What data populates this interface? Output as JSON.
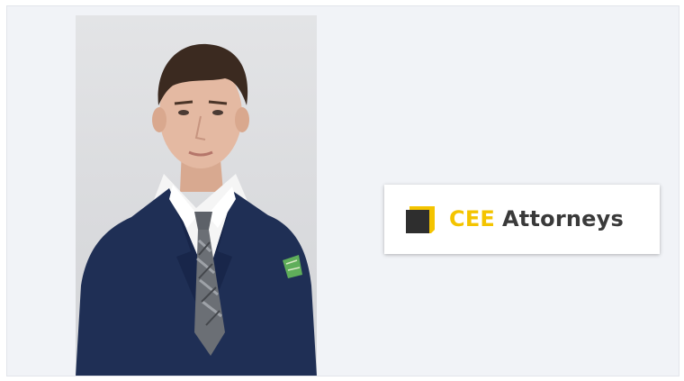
{
  "logo": {
    "brand_primary": "CEE",
    "brand_secondary": "Attorneys",
    "mark_icon": "yellow-cube-icon",
    "colors": {
      "primary": "#f4c400",
      "secondary": "#3a3a3a",
      "mark_dark": "#2e2e2e"
    }
  },
  "portrait": {
    "subject_icon": "person-portrait-icon",
    "colors": {
      "suit": "#1f2f55",
      "shirt": "#f5f5f5",
      "tie": "#6b6f75",
      "pocket_square": "#5fae5a",
      "hair": "#3b2a20",
      "skin": "#e4b9a2",
      "background": "#dcdde0"
    }
  }
}
